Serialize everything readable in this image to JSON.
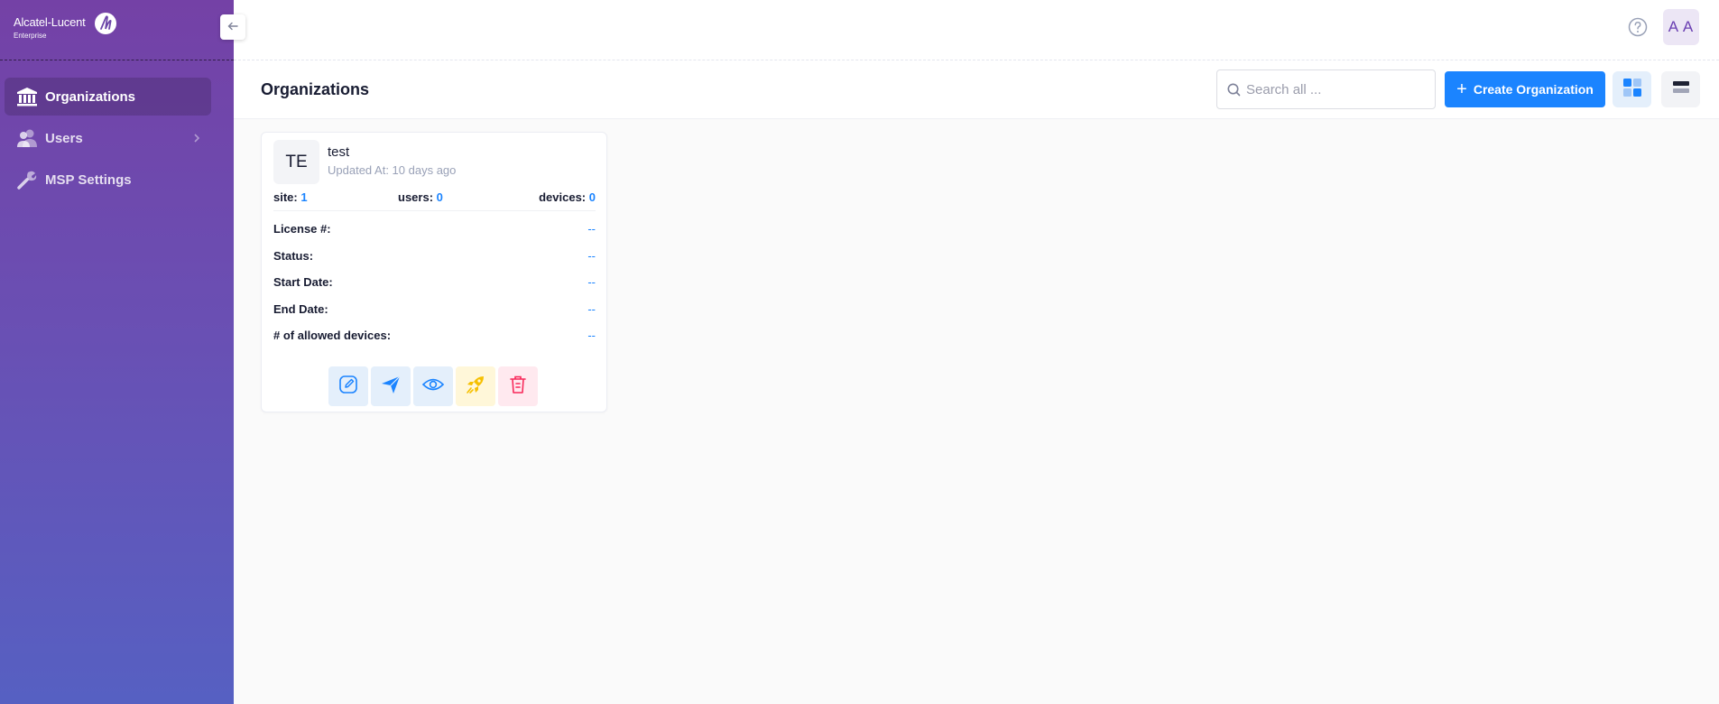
{
  "brand": {
    "name": "Alcatel-Lucent",
    "subtitle": "Enterprise"
  },
  "sidebar": {
    "items": [
      {
        "label": "Organizations",
        "icon": "bank-icon",
        "active": true
      },
      {
        "label": "Users",
        "icon": "users-icon",
        "active": false
      },
      {
        "label": "MSP Settings",
        "icon": "wrench-icon",
        "active": false
      }
    ]
  },
  "header": {
    "avatar_initials": "A A",
    "help_icon": "question-circle-icon"
  },
  "toolbar": {
    "title": "Organizations",
    "search_placeholder": "Search all ...",
    "search_value": "",
    "create_label": "Create Organization",
    "active_view": "grid"
  },
  "organizations": [
    {
      "initials": "TE",
      "name": "test",
      "updated": "Updated At: 10 days ago",
      "stats": {
        "site_label": "site:",
        "site_value": "1",
        "users_label": "users:",
        "users_value": "0",
        "devices_label": "devices:",
        "devices_value": "0"
      },
      "details": [
        {
          "label": "License #:",
          "value": "--"
        },
        {
          "label": "Status:",
          "value": "--"
        },
        {
          "label": "Start Date:",
          "value": "--"
        },
        {
          "label": "End Date:",
          "value": "--"
        },
        {
          "label": "# of allowed devices:",
          "value": "--"
        }
      ],
      "actions": [
        "edit-icon",
        "send-icon",
        "view-icon",
        "rocket-icon",
        "trash-icon"
      ]
    }
  ],
  "colors": {
    "primary": "#1b84ff",
    "sidebar_top": "#7441a6",
    "sidebar_bottom": "#5660c2",
    "avatar_text": "#6a3fb2",
    "danger": "#f8285a",
    "warning": "#f6c000"
  }
}
